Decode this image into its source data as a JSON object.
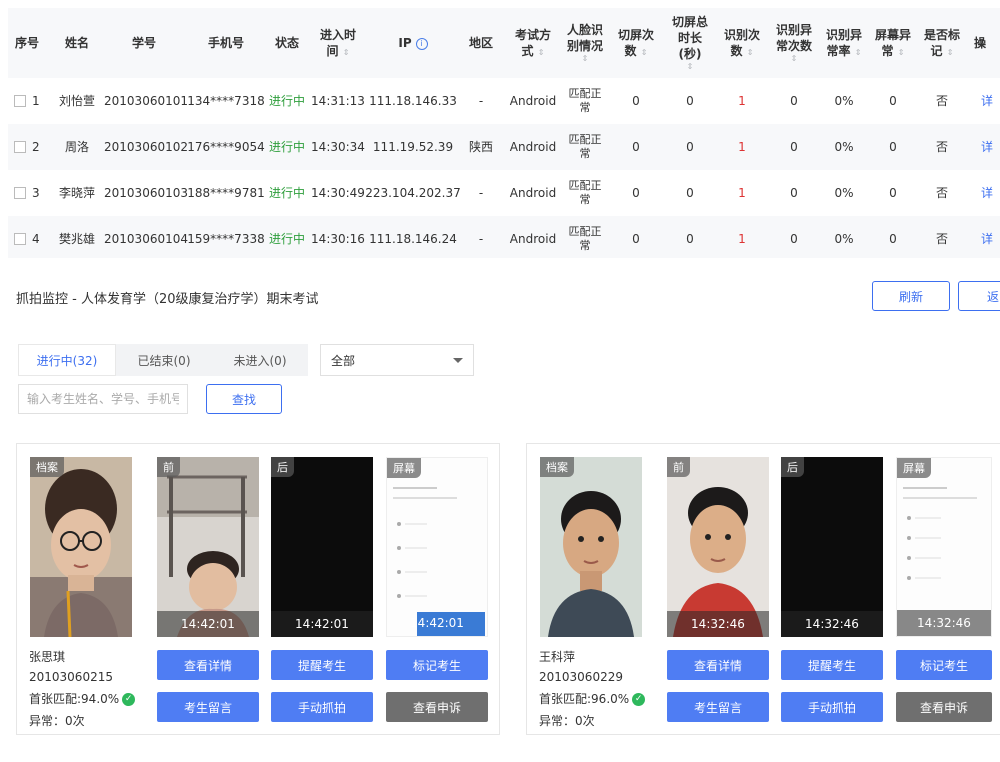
{
  "table": {
    "headers": {
      "no": "序号",
      "name": "姓名",
      "sid": "学号",
      "phone": "手机号",
      "status": "状态",
      "enter_time": [
        "进入时",
        "间"
      ],
      "ip": "IP",
      "region": "地区",
      "exam_mode": [
        "考试方",
        "式"
      ],
      "face": [
        "人脸识",
        "别情况"
      ],
      "switch_count": [
        "切屏次",
        "数"
      ],
      "switch_dur": [
        "切屏总",
        "时长",
        "(秒)"
      ],
      "rec_count": [
        "识别次",
        "数"
      ],
      "rec_abn_count": [
        "识别异",
        "常次数"
      ],
      "rec_abn_rate": [
        "识别异",
        "常率"
      ],
      "screen_abn": [
        "屏幕异",
        "常"
      ],
      "marked": [
        "是否标",
        "记"
      ],
      "op": "操"
    },
    "rows": [
      {
        "no": "1",
        "name": "刘怡萱",
        "sid": "20103060101",
        "phone": "134****7318",
        "status": "进行中",
        "time": "14:31:13",
        "ip": "111.18.146.33",
        "region": "-",
        "mode": "Android",
        "face": [
          "匹配正",
          "常"
        ],
        "sc": "0",
        "sd": "0",
        "rc": "1",
        "rac": "0",
        "rar": "0%",
        "sa": "0",
        "mk": "否",
        "op": "详"
      },
      {
        "no": "2",
        "name": "周洛",
        "sid": "20103060102",
        "phone": "176****9054",
        "status": "进行中",
        "time": "14:30:34",
        "ip": "111.19.52.39",
        "region": "陕西",
        "mode": "Android",
        "face": [
          "匹配正",
          "常"
        ],
        "sc": "0",
        "sd": "0",
        "rc": "1",
        "rac": "0",
        "rar": "0%",
        "sa": "0",
        "mk": "否",
        "op": "详"
      },
      {
        "no": "3",
        "name": "李晓萍",
        "sid": "20103060103",
        "phone": "188****9781",
        "status": "进行中",
        "time": "14:30:49",
        "ip": "223.104.202.37",
        "region": "-",
        "mode": "Android",
        "face": [
          "匹配正",
          "常"
        ],
        "sc": "0",
        "sd": "0",
        "rc": "1",
        "rac": "0",
        "rar": "0%",
        "sa": "0",
        "mk": "否",
        "op": "详"
      },
      {
        "no": "4",
        "name": "樊兆雄",
        "sid": "20103060104",
        "phone": "159****7338",
        "status": "进行中",
        "time": "14:30:16",
        "ip": "111.18.146.24",
        "region": "-",
        "mode": "Android",
        "face": [
          "匹配正",
          "常"
        ],
        "sc": "0",
        "sd": "0",
        "rc": "1",
        "rac": "0",
        "rar": "0%",
        "sa": "0",
        "mk": "否",
        "op": "详"
      }
    ]
  },
  "monitor": {
    "title": "抓拍监控 - 人体发育学（20级康复治疗学）期末考试",
    "refresh": "刷新",
    "back": "返",
    "tabs": [
      "进行中(32)",
      "已结束(0)",
      "未进入(0)"
    ],
    "filter_value": "全部",
    "search_placeholder": "输入考生姓名、学号、手机号",
    "find": "查找"
  },
  "photo_labels": {
    "archive": "档案",
    "front": "前",
    "back": "后",
    "screen": "屏幕"
  },
  "buttons": {
    "detail": "查看详情",
    "remind": "提醒考生",
    "mark": "标记考生",
    "message": "考生留言",
    "capture": "手动抓拍",
    "appeal": "查看申诉"
  },
  "cards": [
    {
      "name": "张思琪",
      "sid": "20103060215",
      "match": "首张匹配:94.0%",
      "abnormal": "异常：0次",
      "time": "14:42:01"
    },
    {
      "name": "王科萍",
      "sid": "20103060229",
      "match": "首张匹配:96.0%",
      "abnormal": "异常：0次",
      "time": "14:32:46"
    }
  ],
  "colors": {
    "accent": "#3d6ff0",
    "status_green": "#2e9e3c",
    "ok_green": "#2eb85c",
    "red_value": "#dd3333"
  }
}
